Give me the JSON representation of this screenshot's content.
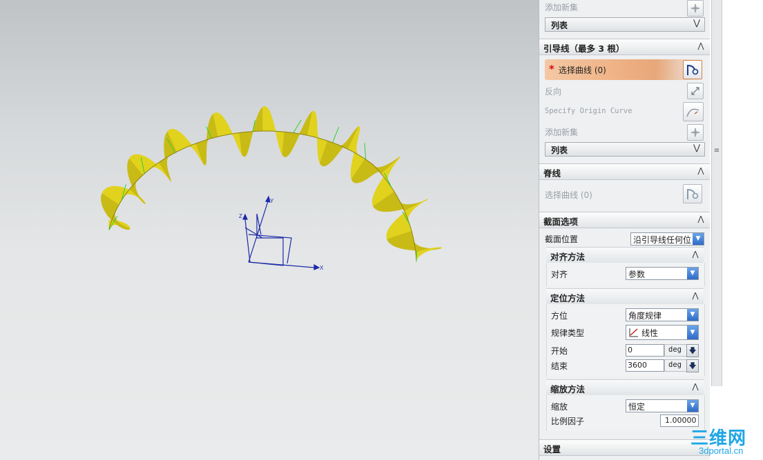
{
  "panel": {
    "top_partial": {
      "add_new_set": "添加新集",
      "list_label": "列表"
    },
    "guides": {
      "title": "引导线（最多 3 根）",
      "select_curve": "选择曲线 (0)",
      "required_mark": "*",
      "reverse": "反向",
      "specify_origin": "Specify Origin Curve",
      "add_new_set": "添加新集",
      "list_label": "列表"
    },
    "spine": {
      "title": "脊线",
      "select_curve": "选择曲线 (0)"
    },
    "section_options": {
      "title": "截面选项",
      "position_label": "截面位置",
      "position_value": "沿引导线任何位"
    },
    "alignment": {
      "title": "对齐方法",
      "label": "对齐",
      "value": "参数"
    },
    "orientation": {
      "title": "定位方法",
      "orient_label": "方位",
      "orient_value": "角度规律",
      "law_label": "规律类型",
      "law_value": "线性",
      "start_label": "开始",
      "start_value": "0",
      "end_label": "结束",
      "end_value": "3600",
      "unit": "deg"
    },
    "scaling": {
      "title": "缩放方法",
      "scale_label": "缩放",
      "scale_value": "恒定",
      "factor_label": "比例因子",
      "factor_value": "1.00000"
    },
    "settings": {
      "title": "设置"
    }
  },
  "viewport": {
    "axis_labels": {
      "x": "X",
      "y": "Y",
      "z": "Z"
    },
    "colors": {
      "helix": "#e1d21e",
      "helix_dark": "#8c8410",
      "normals": "#2fd12f",
      "triad": "#1c2aa8"
    }
  },
  "watermark": {
    "brand": "三维网",
    "site": "3dportal.cn"
  },
  "icons": {
    "collapse": "chevron-up-icon",
    "expand": "chevron-down-icon",
    "dropdown": "dropdown-arrow-icon",
    "step": "down-arrow-icon"
  }
}
